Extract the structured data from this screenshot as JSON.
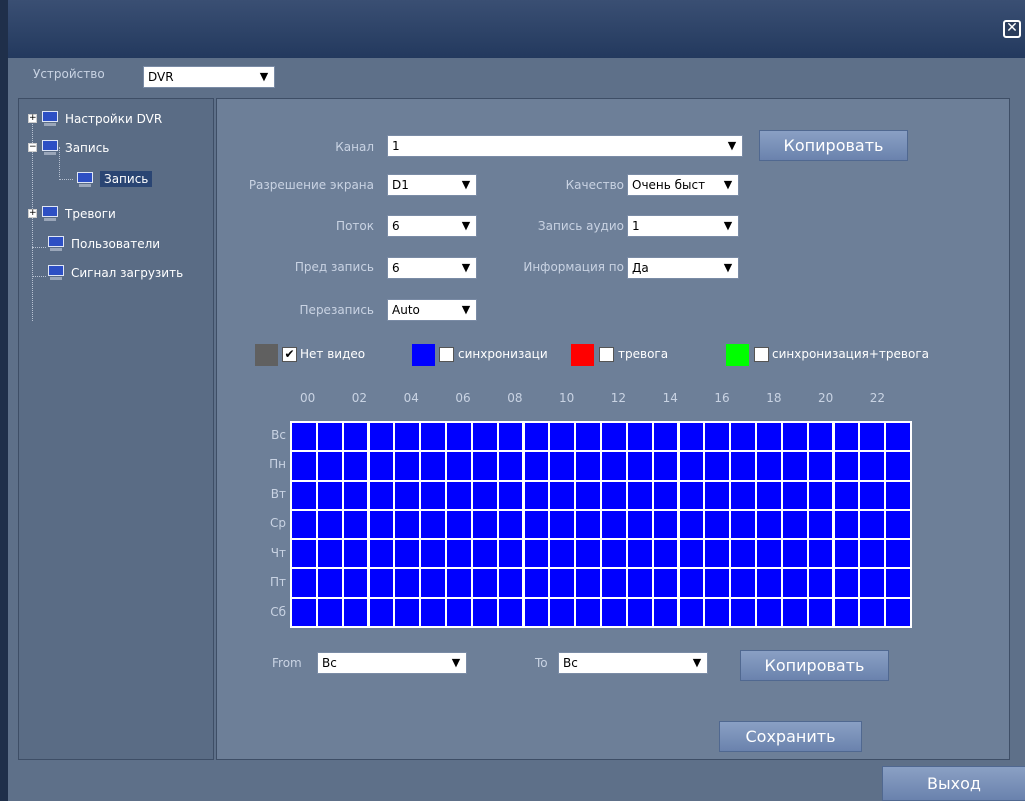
{
  "window": {
    "close_glyph": "✕"
  },
  "device": {
    "label": "Устройство",
    "value": "DVR"
  },
  "tree": {
    "items": [
      {
        "label": "Настройки DVR",
        "expander": "+"
      },
      {
        "label": "Запись",
        "expander": "−"
      },
      {
        "label": "Запись"
      },
      {
        "label": "Тревоги",
        "expander": "+"
      },
      {
        "label": "Пользователи"
      },
      {
        "label": "Сигнал загрузить"
      }
    ]
  },
  "form": {
    "channel": {
      "label": "Канал",
      "value": "1"
    },
    "copy_label": "Копировать",
    "resolution": {
      "label": "Разрешение экрана",
      "value": "D1"
    },
    "quality": {
      "label": "Качество",
      "value": "Очень быст"
    },
    "stream": {
      "label": "Поток",
      "value": "6"
    },
    "audio": {
      "label": "Запись аудио",
      "value": "1"
    },
    "prerecord": {
      "label": "Пред запись",
      "value": "6"
    },
    "info": {
      "label": "Информация по",
      "value": "Да"
    },
    "overwrite": {
      "label": "Перезапись",
      "value": "Auto"
    }
  },
  "legend": [
    {
      "label": "Нет видео",
      "color": "#606060",
      "checked": "✔"
    },
    {
      "label": "синхронизаци",
      "color": "#0000ff",
      "checked": ""
    },
    {
      "label": "тревога",
      "color": "#ff0000",
      "checked": ""
    },
    {
      "label": "синхронизация+тревога",
      "color": "#00ff00",
      "checked": ""
    }
  ],
  "schedule": {
    "hours": [
      "00",
      "02",
      "04",
      "06",
      "08",
      "10",
      "12",
      "14",
      "16",
      "18",
      "20",
      "22"
    ],
    "days": [
      "Вс",
      "Пн",
      "Вт",
      "Ср",
      "Чт",
      "Пт",
      "Сб"
    ],
    "slots_per_day": 24,
    "cell_color": "#0000ff"
  },
  "copy_days": {
    "from_label": "From",
    "from_value": "Вс",
    "to_label": "To",
    "to_value": "Вс",
    "copy_label": "Копировать"
  },
  "save_label": "Сохранить",
  "exit_label": "Выход",
  "icons": {
    "dropdown": "chevron-down-icon",
    "monitor": "monitor-icon"
  }
}
